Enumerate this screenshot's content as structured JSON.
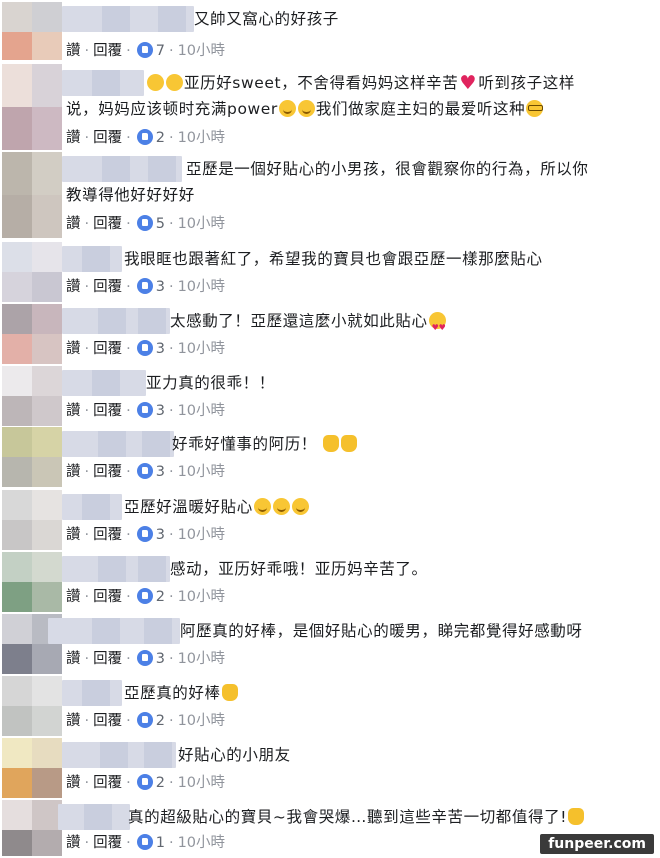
{
  "actions": {
    "like": "讚",
    "reply": "回覆",
    "separator": "·"
  },
  "comments": [
    {
      "text": "又帥又窩心的好孩子",
      "likes": "7",
      "time": "10小時"
    },
    {
      "line1_before": "亚历好sweet，不舍得看妈妈这样辛苦",
      "line1_after": "听到孩子这样",
      "line2_before": "说，妈妈应该顿时充满power",
      "line2_after": "我们做家庭主妇的最爱听这种",
      "likes": "2",
      "time": "10小時"
    },
    {
      "line1": "亞歷是一個好貼心的小男孩，很會觀察你的行為，所以你",
      "line2": "教導得他好好好好",
      "likes": "5",
      "time": "10小時"
    },
    {
      "text": "我眼眶也跟著紅了，希望我的寶貝也會跟亞歷一樣那麼貼心",
      "likes": "3",
      "time": "10小時"
    },
    {
      "text": "太感動了！亞歷還這麼小就如此貼心",
      "likes": "3",
      "time": "10小時"
    },
    {
      "text": "亚力真的很乖！！",
      "likes": "3",
      "time": "10小時"
    },
    {
      "text": "好乖好懂事的阿历！",
      "likes": "3",
      "time": "10小時"
    },
    {
      "text": "亞歷好溫暖好貼心",
      "likes": "3",
      "time": "10小時"
    },
    {
      "text": "感动，亚历好乖哦！亚历妈辛苦了。",
      "likes": "2",
      "time": "10小時"
    },
    {
      "text": "阿歷真的好棒，是個好貼心的暖男，睇完都覺得好感動呀",
      "likes": "3",
      "time": "10小時"
    },
    {
      "text": "亞歷真的好棒",
      "likes": "2",
      "time": "10小時"
    },
    {
      "text": "好貼心的小朋友",
      "likes": "2",
      "time": "10小時"
    },
    {
      "text": "真的超級貼心的寶貝~我會哭爆…聽到這些辛苦一切都值得了!",
      "likes": "1",
      "time": "10小時"
    }
  ],
  "watermark": "funpeer.com",
  "colors": {
    "like_blue": "#4c80e6",
    "text": "#1c1e21",
    "time_gray": "#90949c"
  }
}
